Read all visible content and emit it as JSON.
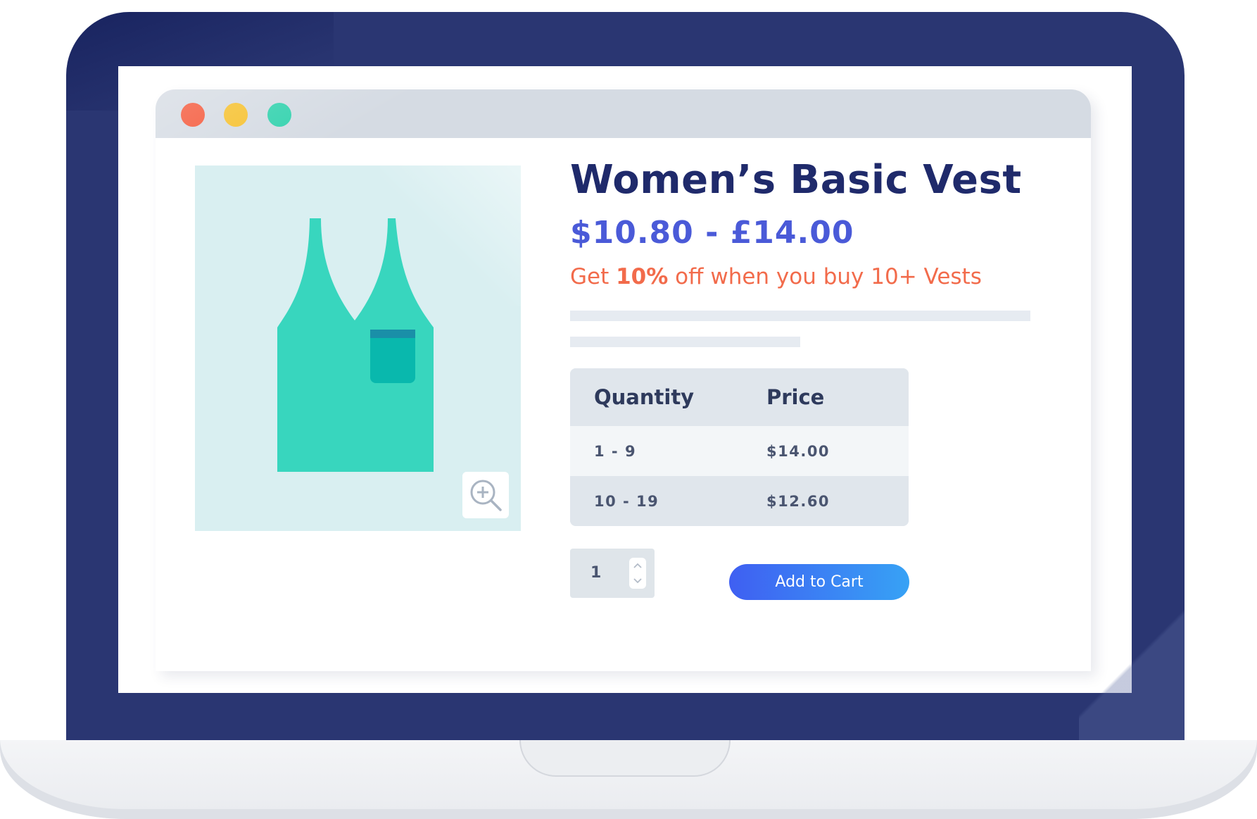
{
  "window": {
    "controls": [
      {
        "name": "close",
        "color": "#f4583a"
      },
      {
        "name": "minimize",
        "color": "#f6c12f"
      },
      {
        "name": "maximize",
        "color": "#33d2ae"
      }
    ]
  },
  "product": {
    "title": "Women’s Basic Vest",
    "price_range": "$10.80 - £14.00",
    "promo": {
      "prefix": "Get ",
      "highlight": "10%",
      "suffix": " off when you buy 10+ Vests"
    },
    "image_icon": "vest-icon",
    "zoom_icon": "zoom-in-icon"
  },
  "pricing_table": {
    "headers": [
      "Quantity",
      "Price"
    ],
    "rows": [
      [
        "1 - 9",
        "$14.00"
      ],
      [
        "10 - 19",
        "$12.60"
      ]
    ]
  },
  "quantity": {
    "value": "1"
  },
  "add_to_cart": {
    "label": "Add to Cart"
  },
  "colors": {
    "bezel": "#2a3672",
    "title": "#1f2a6b",
    "price": "#4a5ad8",
    "promo": "#f26b4b",
    "vest": "#38d6be",
    "vest_pocket": "#09b8ad",
    "button_start": "#3f5ff2",
    "button_end": "#37a2f5"
  }
}
